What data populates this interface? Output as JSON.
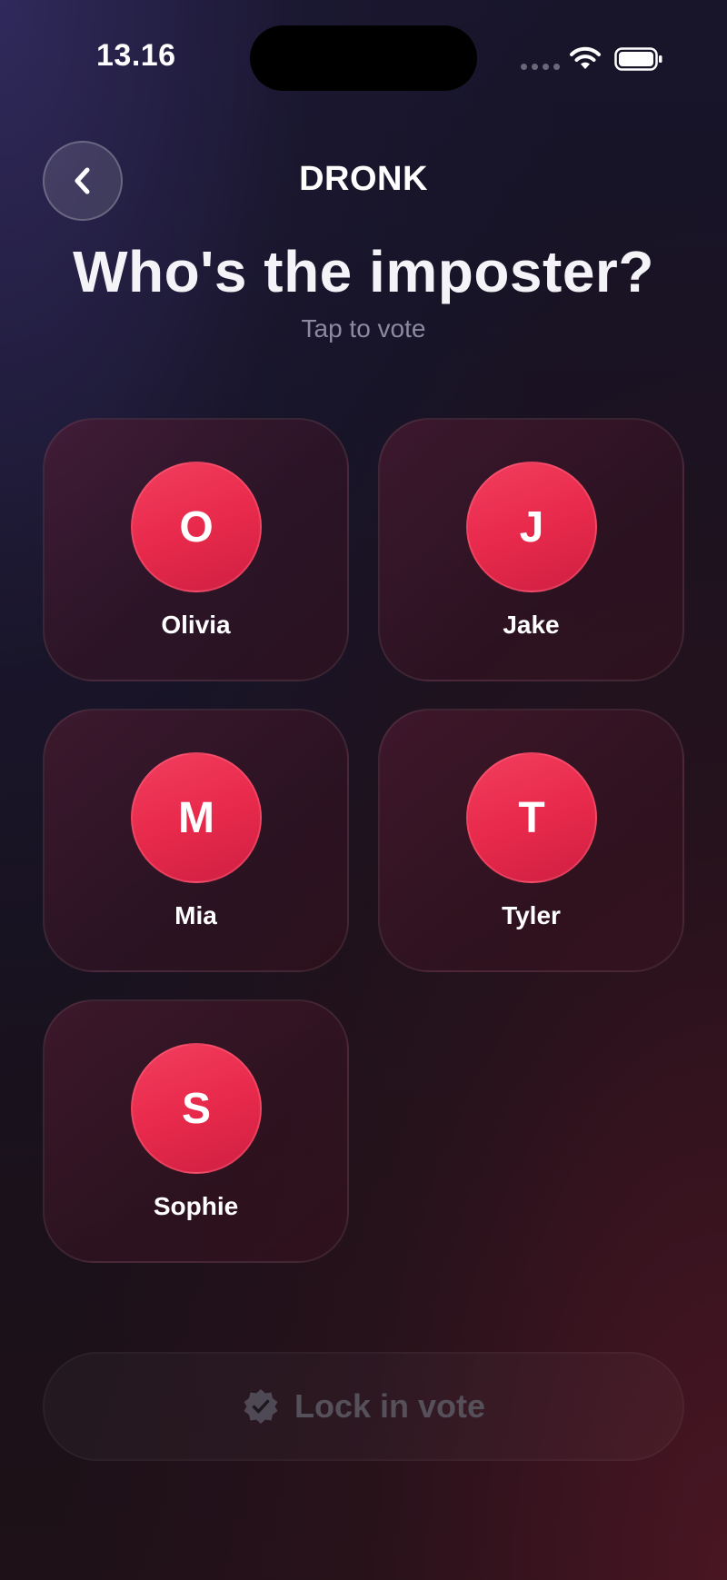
{
  "status_bar": {
    "time": "13.16"
  },
  "header": {
    "app_title": "DRONK",
    "back_icon": "chevron-left-icon"
  },
  "main": {
    "title": "Who's the imposter?",
    "subtitle": "Tap to vote",
    "players": [
      {
        "initial": "O",
        "name": "Olivia"
      },
      {
        "initial": "J",
        "name": "Jake"
      },
      {
        "initial": "M",
        "name": "Mia"
      },
      {
        "initial": "T",
        "name": "Tyler"
      },
      {
        "initial": "S",
        "name": "Sophie"
      }
    ]
  },
  "footer": {
    "lock_label": "Lock in vote",
    "lock_icon": "check-badge-icon"
  },
  "colors": {
    "accent": "#e82a4c",
    "background": "#151222",
    "muted_text": "#8c8aa0",
    "disabled_text": "#55505a"
  }
}
